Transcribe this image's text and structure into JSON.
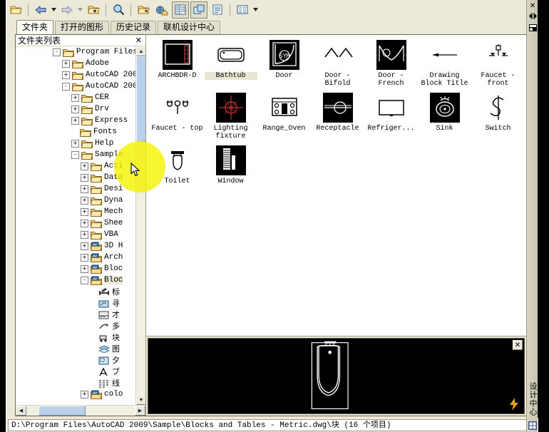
{
  "window": {
    "vertical_title": "设计中心",
    "vbuttons": [
      {
        "name": "close",
        "glyph": "✕"
      },
      {
        "name": "autohide",
        "glyph": "◀▶"
      },
      {
        "name": "properties",
        "glyph": "▤"
      }
    ]
  },
  "toolbar": {
    "buttons": [
      {
        "name": "load-button",
        "icon": "folder-open-icon",
        "pressed": false
      },
      {
        "name": "back-button",
        "icon": "back-arrow-icon",
        "pressed": false,
        "dropdown": true
      },
      {
        "name": "forward-button",
        "icon": "forward-arrow-icon",
        "pressed": false,
        "dropdown": true
      },
      {
        "name": "up-button",
        "icon": "folder-up-icon",
        "pressed": false
      },
      {
        "name": "search-button",
        "icon": "search-icon",
        "pressed": false
      },
      {
        "name": "favorites-button",
        "icon": "favorites-icon",
        "pressed": false
      },
      {
        "name": "home-button",
        "icon": "home-icon",
        "pressed": false
      },
      {
        "name": "tree-view-toggle-button",
        "icon": "tree-view-icon",
        "pressed": true
      },
      {
        "name": "preview-toggle-button",
        "icon": "preview-pane-icon",
        "pressed": true
      },
      {
        "name": "description-toggle-button",
        "icon": "description-pane-icon",
        "pressed": false
      },
      {
        "name": "views-button",
        "icon": "views-icon",
        "pressed": false,
        "dropdown": true
      }
    ]
  },
  "tabs": [
    {
      "label": "文件夹",
      "active": true
    },
    {
      "label": "打开的图形",
      "active": false
    },
    {
      "label": "历史记录",
      "active": false
    },
    {
      "label": "联机设计中心",
      "active": false
    }
  ],
  "tree": {
    "header_title": "文件夹列表",
    "close_glyph": "✕",
    "nodes": [
      {
        "label": "Program Files",
        "indent": 4,
        "expander": "-",
        "icon": "folder-icon",
        "selected": false
      },
      {
        "label": "Adobe",
        "indent": 5,
        "expander": "+",
        "icon": "folder-icon",
        "selected": false
      },
      {
        "label": "AutoCAD 200",
        "indent": 5,
        "expander": "+",
        "icon": "folder-icon",
        "selected": false
      },
      {
        "label": "AutoCAD 200",
        "indent": 5,
        "expander": "-",
        "icon": "folder-icon",
        "selected": false
      },
      {
        "label": "CER",
        "indent": 6,
        "expander": "+",
        "icon": "folder-icon",
        "selected": false
      },
      {
        "label": "Drv",
        "indent": 6,
        "expander": "+",
        "icon": "folder-icon",
        "selected": false
      },
      {
        "label": "Express",
        "indent": 6,
        "expander": "+",
        "icon": "folder-icon",
        "selected": false
      },
      {
        "label": "Fonts",
        "indent": 6,
        "expander": "",
        "icon": "folder-icon",
        "selected": false
      },
      {
        "label": "Help",
        "indent": 6,
        "expander": "+",
        "icon": "folder-icon",
        "selected": false
      },
      {
        "label": "Sample",
        "indent": 6,
        "expander": "-",
        "icon": "folder-icon",
        "selected": false
      },
      {
        "label": "Acti",
        "indent": 7,
        "expander": "+",
        "icon": "folder-icon",
        "selected": false
      },
      {
        "label": "Data",
        "indent": 7,
        "expander": "+",
        "icon": "folder-icon",
        "selected": false
      },
      {
        "label": "Desi",
        "indent": 7,
        "expander": "+",
        "icon": "folder-icon",
        "selected": false
      },
      {
        "label": "Dyna",
        "indent": 7,
        "expander": "+",
        "icon": "folder-icon",
        "selected": false
      },
      {
        "label": "Mech",
        "indent": 7,
        "expander": "+",
        "icon": "folder-icon",
        "selected": false
      },
      {
        "label": "Shee",
        "indent": 7,
        "expander": "+",
        "icon": "folder-icon",
        "selected": false
      },
      {
        "label": "VBA",
        "indent": 7,
        "expander": "+",
        "icon": "folder-icon",
        "selected": false
      },
      {
        "label": "3D H",
        "indent": 7,
        "expander": "+",
        "icon": "drawing-file-icon",
        "selected": false
      },
      {
        "label": "Arch",
        "indent": 7,
        "expander": "+",
        "icon": "drawing-file-icon",
        "selected": false
      },
      {
        "label": "Bloc",
        "indent": 7,
        "expander": "+",
        "icon": "drawing-file-icon",
        "selected": false
      },
      {
        "label": "Bloc",
        "indent": 7,
        "expander": "-",
        "icon": "drawing-file-icon",
        "selected": true
      },
      {
        "label": "标",
        "indent": 8,
        "expander": "",
        "icon": "dimstyle-icon",
        "selected": false
      },
      {
        "label": "寻",
        "indent": 8,
        "expander": "",
        "icon": "xref-icon",
        "selected": false
      },
      {
        "label": "才",
        "indent": 8,
        "expander": "",
        "icon": "layout-icon",
        "selected": false
      },
      {
        "label": "多",
        "indent": 8,
        "expander": "",
        "icon": "multileader-icon",
        "selected": false
      },
      {
        "label": "块",
        "indent": 8,
        "expander": "",
        "icon": "block-icon",
        "selected": false
      },
      {
        "label": "图",
        "indent": 8,
        "expander": "",
        "icon": "layer-icon",
        "selected": false
      },
      {
        "label": "夕",
        "indent": 8,
        "expander": "",
        "icon": "external-ref-icon",
        "selected": false
      },
      {
        "label": "ブ",
        "indent": 8,
        "expander": "",
        "icon": "textstyle-icon",
        "selected": false
      },
      {
        "label": "线",
        "indent": 8,
        "expander": "",
        "icon": "linetype-icon",
        "selected": false
      },
      {
        "label": "colo",
        "indent": 7,
        "expander": "+",
        "icon": "drawing-file-icon",
        "selected": false
      }
    ]
  },
  "items": [
    {
      "label": "ARCHBDR-D",
      "icon": "archbdr-thumb",
      "selected": false
    },
    {
      "label": "Bathtub",
      "icon": "bathtub-thumb",
      "selected": true
    },
    {
      "label": "Door",
      "icon": "door-thumb",
      "selected": false
    },
    {
      "label": "Door - Bifold",
      "icon": "door-bifold-thumb",
      "selected": false
    },
    {
      "label": "Door - French",
      "icon": "door-french-thumb",
      "selected": false
    },
    {
      "label": "Drawing Block Title",
      "icon": "drawing-block-title-thumb",
      "selected": false
    },
    {
      "label": "Faucet - front",
      "icon": "faucet-front-thumb",
      "selected": false
    },
    {
      "label": "Faucet - top",
      "icon": "faucet-top-thumb",
      "selected": false
    },
    {
      "label": "Lighting fixture",
      "icon": "lighting-fixture-thumb",
      "selected": false
    },
    {
      "label": "Range_Oven",
      "icon": "range-oven-thumb",
      "selected": false
    },
    {
      "label": "Receptacle",
      "icon": "receptacle-thumb",
      "selected": false
    },
    {
      "label": "Refriger...",
      "icon": "refrigerator-thumb",
      "selected": false
    },
    {
      "label": "Sink",
      "icon": "sink-thumb",
      "selected": false
    },
    {
      "label": "Switch",
      "icon": "switch-thumb",
      "selected": false
    },
    {
      "label": "Toilet",
      "icon": "toilet-thumb",
      "selected": false
    },
    {
      "label": "Window",
      "icon": "window-thumb",
      "selected": false
    }
  ],
  "preview": {
    "close_glyph": "✕",
    "drawing": "toilet-preview"
  },
  "statusbar": {
    "path": "D:\\Program Files\\AutoCAD 2009\\Sample\\Blocks and Tables - Metric.dwg\\块  (16 个项目)"
  },
  "colors": {
    "panel_bg": "#ece9d8",
    "accent": "#f3f305",
    "preview_bg": "#000000",
    "selection": "#b8d0ea"
  }
}
